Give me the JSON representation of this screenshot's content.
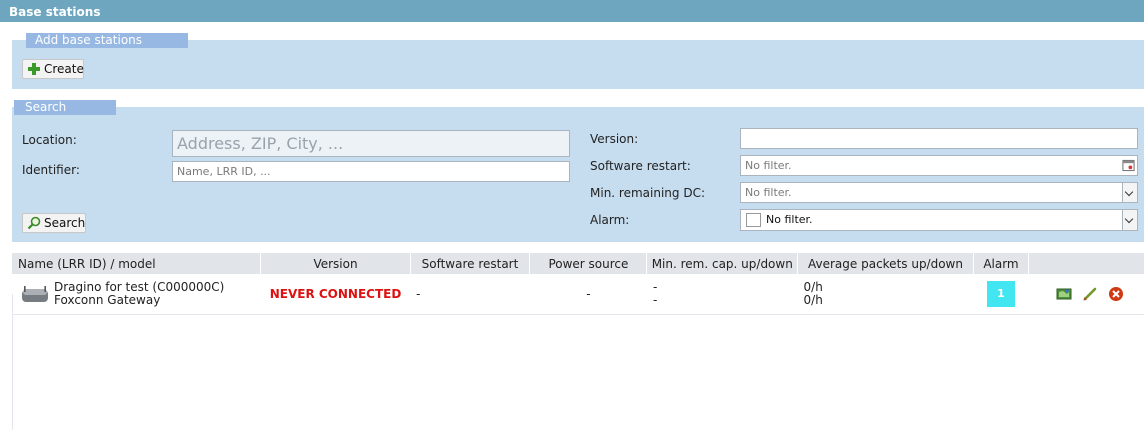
{
  "page_title": "Base stations",
  "add_section": {
    "legend": "Add base stations",
    "create_label": "Create"
  },
  "search_section": {
    "legend": "Search",
    "location": {
      "label": "Location:",
      "placeholder": "Address, ZIP, City, ..."
    },
    "identifier": {
      "label": "Identifier:",
      "placeholder": "Name, LRR ID, ..."
    },
    "version": {
      "label": "Version:",
      "value": ""
    },
    "software_restart": {
      "label": "Software restart:",
      "value": "No filter."
    },
    "min_remaining_dc": {
      "label": "Min. remaining DC:",
      "value": "No filter."
    },
    "alarm": {
      "label": "Alarm:",
      "value": "No filter."
    },
    "search_label": "Search"
  },
  "table": {
    "columns": [
      "Name (LRR ID) / model",
      "Version",
      "Software restart",
      "Power source",
      "Min. rem. cap. up/down",
      "Average packets up/down",
      "Alarm",
      ""
    ],
    "rows": [
      {
        "name": "Dragino for test (C000000C)",
        "model": "Foxconn Gateway",
        "version": "NEVER CONNECTED",
        "software_restart": "-",
        "power_source": "-",
        "min_rem_up": "-",
        "min_rem_down": "-",
        "avg_up": "0/h",
        "avg_down": "0/h",
        "alarm": "1"
      }
    ]
  },
  "colors": {
    "titlebar": "#6ea6c0",
    "panel": "#c6dcef",
    "legend": "#96b8e2",
    "never_connected": "#dd1111",
    "alarm_badge": "#41e6f0"
  }
}
